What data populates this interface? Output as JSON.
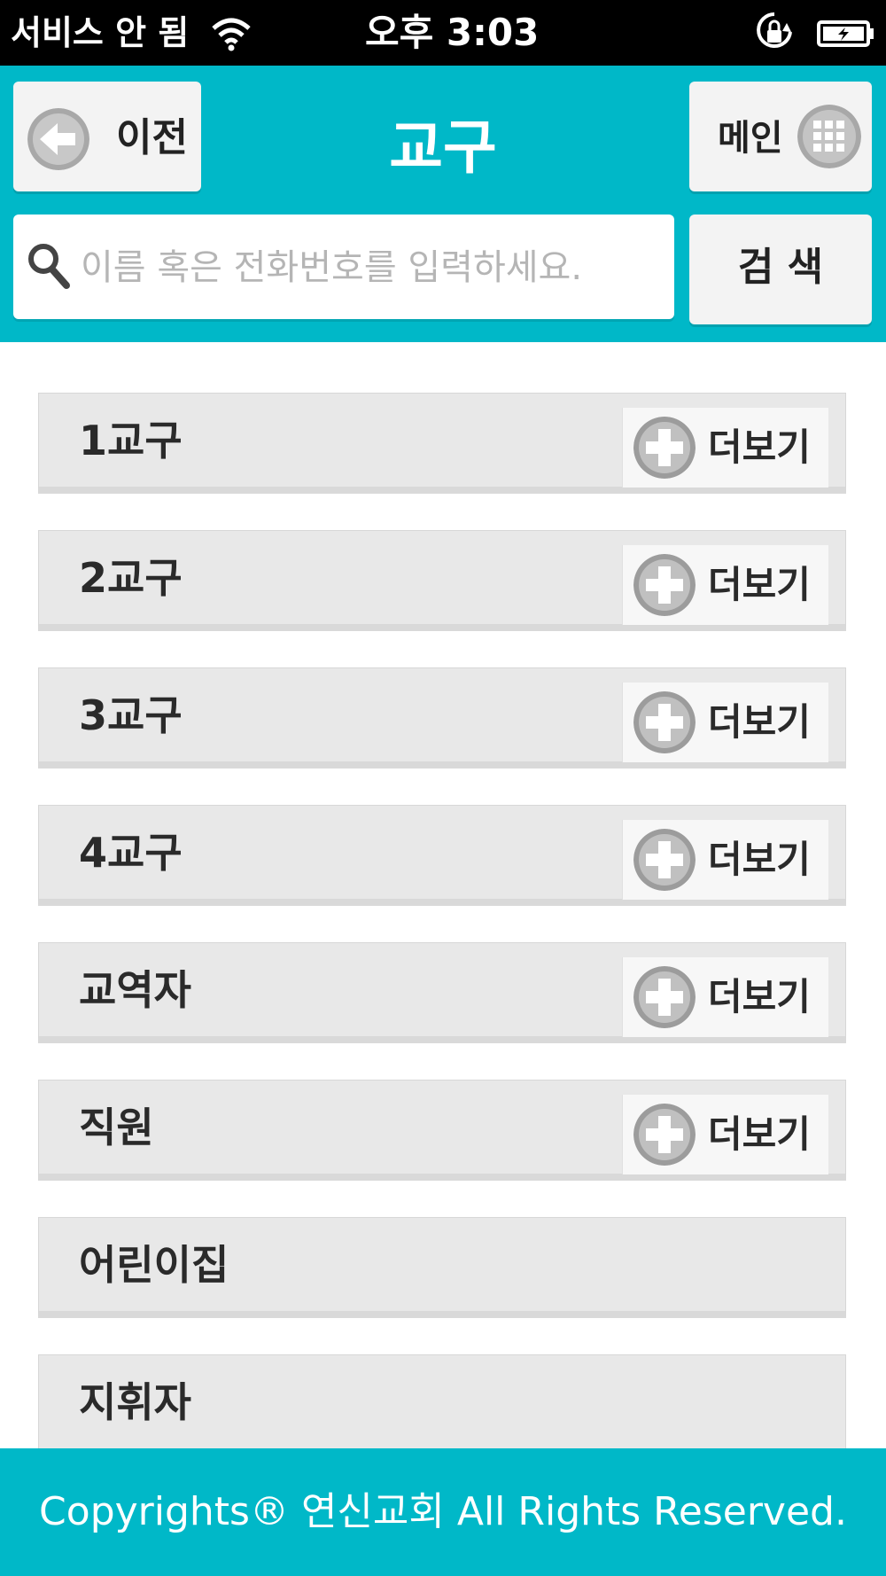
{
  "status_bar": {
    "carrier": "서비스 안 됨",
    "time": "오후 3:03",
    "icons": [
      "wifi-icon",
      "rotation-lock-icon",
      "battery-charging-icon"
    ]
  },
  "header": {
    "back_label": "이전",
    "title": "교구",
    "main_label": "메인",
    "search_placeholder": "이름 혹은 전화번호를 입력하세요.",
    "search_label": "검 색"
  },
  "list": {
    "more_label": "더보기",
    "items": [
      {
        "label": "1교구",
        "has_more": true
      },
      {
        "label": "2교구",
        "has_more": true
      },
      {
        "label": "3교구",
        "has_more": true
      },
      {
        "label": "4교구",
        "has_more": true
      },
      {
        "label": "교역자",
        "has_more": true
      },
      {
        "label": "직원",
        "has_more": true
      },
      {
        "label": "어린이집",
        "has_more": false
      },
      {
        "label": "지휘자",
        "has_more": false
      }
    ]
  },
  "footer": {
    "text": "Copyrights® 연신교회 All Rights Reserved."
  },
  "colors": {
    "accent": "#00b8c8",
    "row_bg": "#e8e8e8",
    "button_bg": "#f3f3f3"
  }
}
